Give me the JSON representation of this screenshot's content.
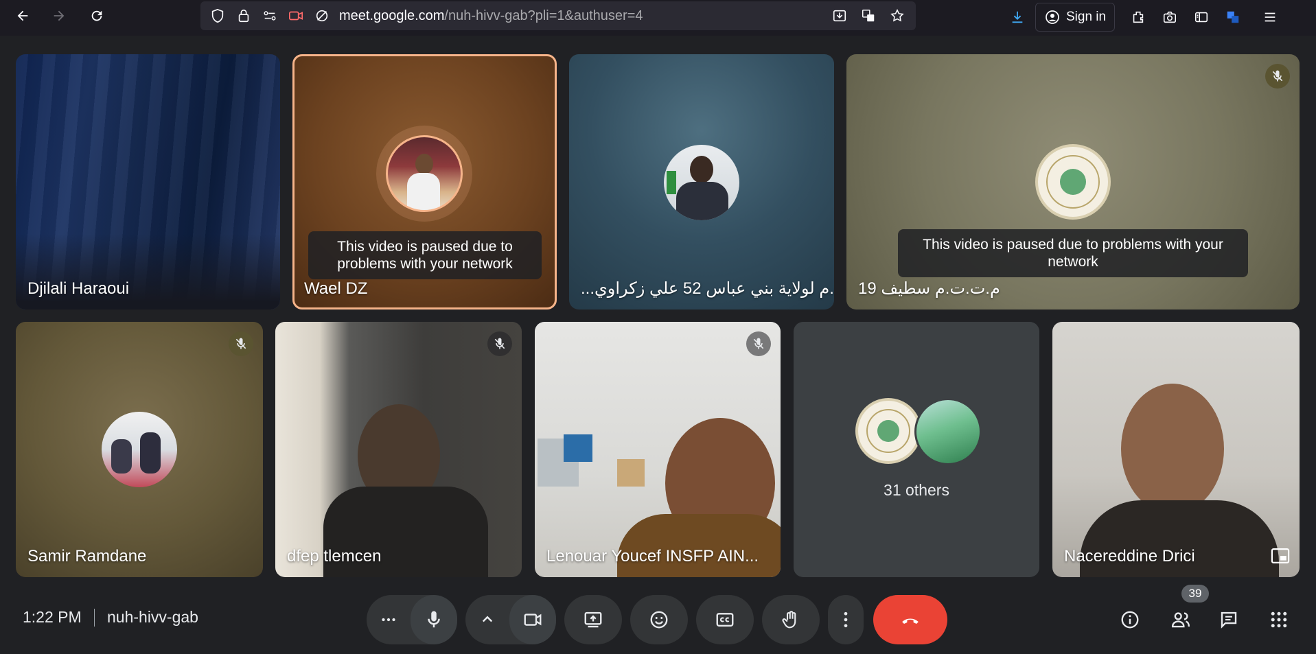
{
  "browser": {
    "url_domain": "meet.google.com",
    "url_path": "/nuh-hivv-gab?pli=1&authuser=4",
    "sign_in_label": "Sign in"
  },
  "tiles": [
    {
      "name": "Djilali Haraoui",
      "muted": false
    },
    {
      "name": "Wael DZ",
      "paused_message": "This video is paused due to problems with your network",
      "muted": false
    },
    {
      "name": "ت.م لولاية بني عباس 52 علي زكراوي...",
      "muted": false
    },
    {
      "name": "م.ت.ت.م سطيف 19",
      "paused_message": "This video is paused due to problems with your network",
      "muted": true
    },
    {
      "name": "Samir Ramdane",
      "muted": true
    },
    {
      "name": "dfep tlemcen",
      "muted": true
    },
    {
      "name": "Lenouar Youcef INSFP AIN...",
      "muted": true
    },
    {
      "name": "31 others"
    },
    {
      "name": "Nacereddine Drici"
    }
  ],
  "bottom": {
    "time": "1:22 PM",
    "meeting_code": "nuh-hivv-gab",
    "participant_count": "39"
  },
  "colors": {
    "end_call": "#ea4335",
    "active_speaker_border": "#f6b48a",
    "control_bg": "#333537"
  }
}
